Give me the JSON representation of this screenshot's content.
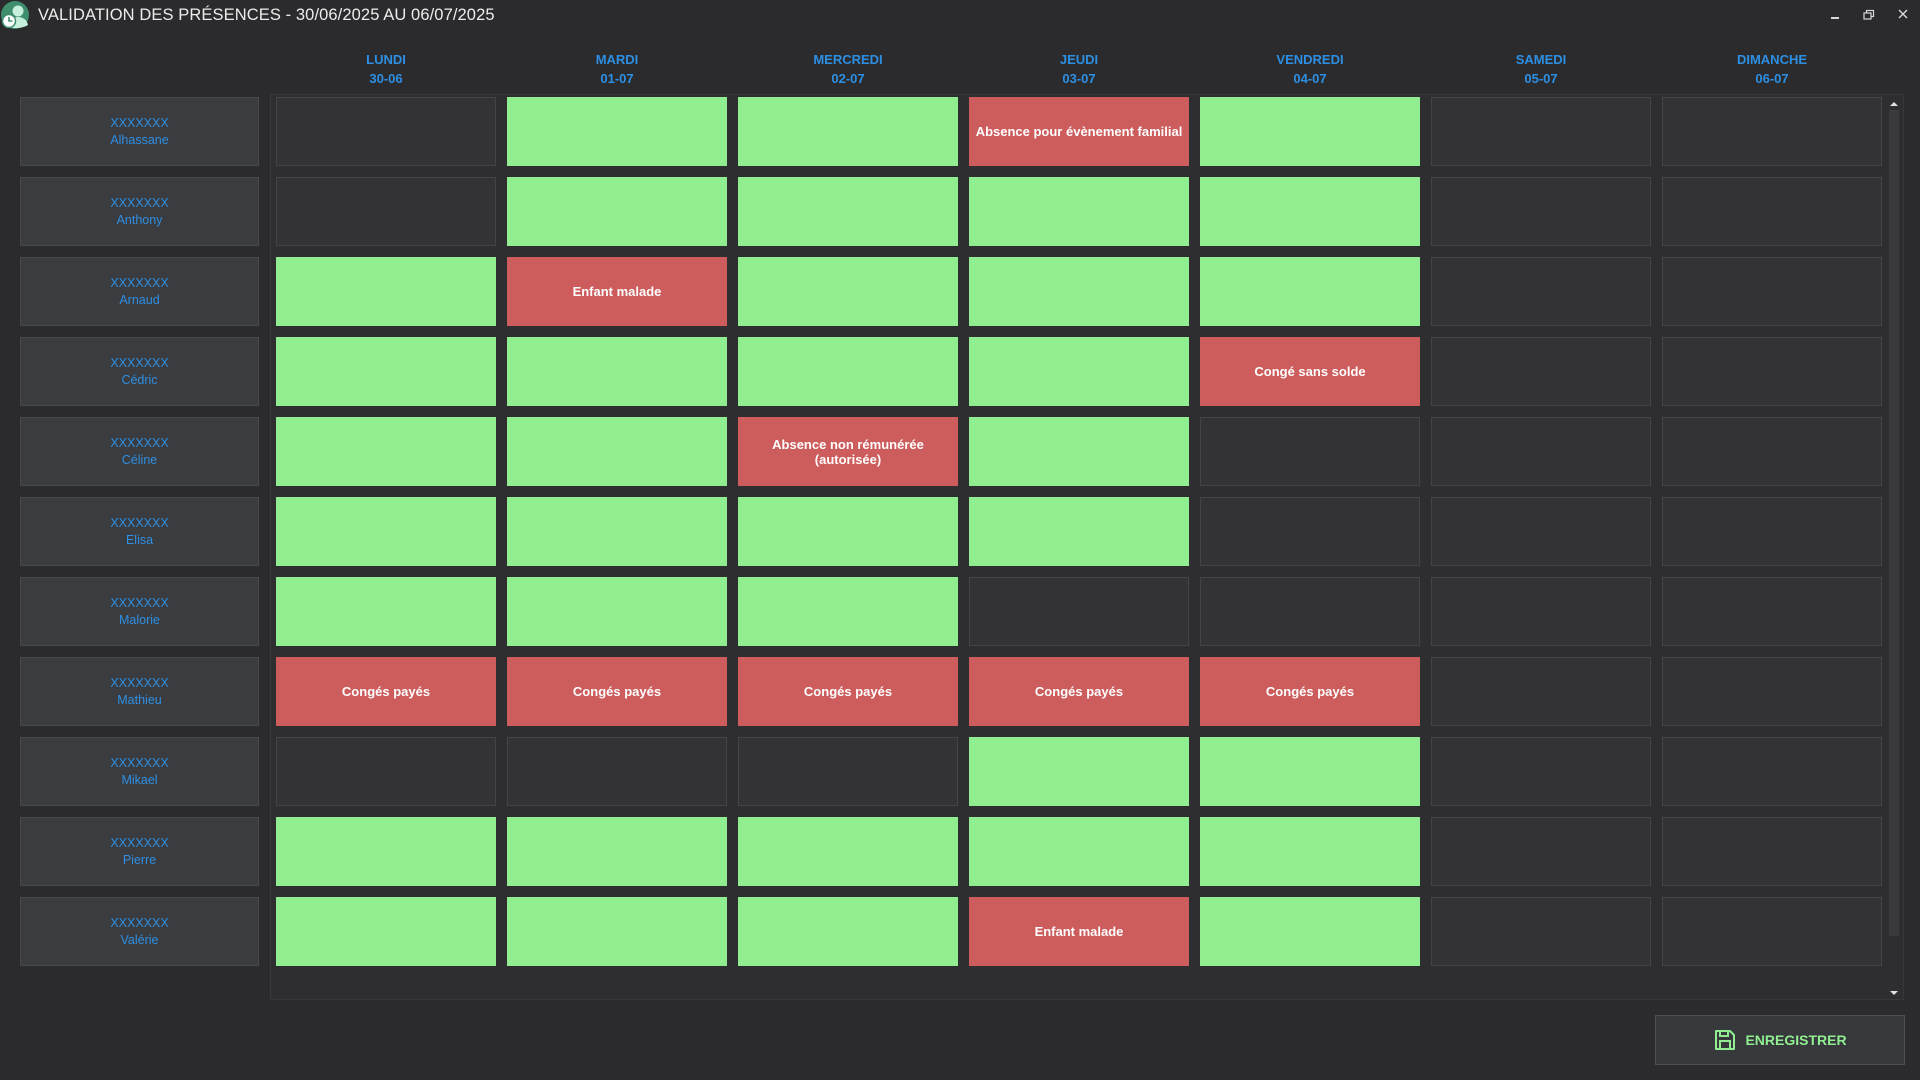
{
  "window": {
    "title": "VALIDATION DES PRÉSENCES - 30/06/2025 AU 06/07/2025"
  },
  "icons": {
    "app": "user-clock-icon",
    "minimize": "minimize-icon",
    "restore": "restore-icon",
    "close": "close-icon",
    "save": "floppy-disk-icon",
    "scroll_up": "scroll-up-arrow-icon",
    "scroll_down": "scroll-down-arrow-icon"
  },
  "colors": {
    "accent": "#2d8fe3",
    "present": "#90ee90",
    "absent": "#cd5c5c",
    "empty": "#333337",
    "background": "#2b2b2e"
  },
  "days": [
    {
      "name": "LUNDI",
      "date": "30-06"
    },
    {
      "name": "MARDI",
      "date": "01-07"
    },
    {
      "name": "MERCREDI",
      "date": "02-07"
    },
    {
      "name": "JEUDI",
      "date": "03-07"
    },
    {
      "name": "VENDREDI",
      "date": "04-07"
    },
    {
      "name": "SAMEDI",
      "date": "05-07"
    },
    {
      "name": "DIMANCHE",
      "date": "06-07"
    }
  ],
  "employees": [
    {
      "surname": "XXXXXXX",
      "firstname": "Alhassane",
      "cells": [
        {
          "status": "empty"
        },
        {
          "status": "present"
        },
        {
          "status": "present"
        },
        {
          "status": "absent",
          "label": "Absence pour évènement familial"
        },
        {
          "status": "present"
        },
        {
          "status": "empty"
        },
        {
          "status": "empty"
        }
      ]
    },
    {
      "surname": "XXXXXXX",
      "firstname": "Anthony",
      "cells": [
        {
          "status": "empty"
        },
        {
          "status": "present"
        },
        {
          "status": "present"
        },
        {
          "status": "present"
        },
        {
          "status": "present"
        },
        {
          "status": "empty"
        },
        {
          "status": "empty"
        }
      ]
    },
    {
      "surname": "XXXXXXX",
      "firstname": "Arnaud",
      "cells": [
        {
          "status": "present"
        },
        {
          "status": "absent",
          "label": "Enfant malade"
        },
        {
          "status": "present"
        },
        {
          "status": "present"
        },
        {
          "status": "present"
        },
        {
          "status": "empty"
        },
        {
          "status": "empty"
        }
      ]
    },
    {
      "surname": "XXXXXXX",
      "firstname": "Cédric",
      "cells": [
        {
          "status": "present"
        },
        {
          "status": "present"
        },
        {
          "status": "present"
        },
        {
          "status": "present"
        },
        {
          "status": "absent",
          "label": "Congé sans solde"
        },
        {
          "status": "empty"
        },
        {
          "status": "empty"
        }
      ]
    },
    {
      "surname": "XXXXXXX",
      "firstname": "Céline",
      "cells": [
        {
          "status": "present"
        },
        {
          "status": "present"
        },
        {
          "status": "absent",
          "label": "Absence non rémunérée (autorisée)"
        },
        {
          "status": "present"
        },
        {
          "status": "empty"
        },
        {
          "status": "empty"
        },
        {
          "status": "empty"
        }
      ]
    },
    {
      "surname": "XXXXXXX",
      "firstname": "Elisa",
      "cells": [
        {
          "status": "present"
        },
        {
          "status": "present"
        },
        {
          "status": "present"
        },
        {
          "status": "present"
        },
        {
          "status": "empty"
        },
        {
          "status": "empty"
        },
        {
          "status": "empty"
        }
      ]
    },
    {
      "surname": "XXXXXXX",
      "firstname": "Malorie",
      "cells": [
        {
          "status": "present"
        },
        {
          "status": "present"
        },
        {
          "status": "present"
        },
        {
          "status": "empty"
        },
        {
          "status": "empty"
        },
        {
          "status": "empty"
        },
        {
          "status": "empty"
        }
      ]
    },
    {
      "surname": "XXXXXXX",
      "firstname": "Mathieu",
      "cells": [
        {
          "status": "absent",
          "label": "Congés payés"
        },
        {
          "status": "absent",
          "label": "Congés payés"
        },
        {
          "status": "absent",
          "label": "Congés payés"
        },
        {
          "status": "absent",
          "label": "Congés payés"
        },
        {
          "status": "absent",
          "label": "Congés payés"
        },
        {
          "status": "empty"
        },
        {
          "status": "empty"
        }
      ]
    },
    {
      "surname": "XXXXXXX",
      "firstname": "Mikael",
      "cells": [
        {
          "status": "empty"
        },
        {
          "status": "empty"
        },
        {
          "status": "empty"
        },
        {
          "status": "present"
        },
        {
          "status": "present"
        },
        {
          "status": "empty"
        },
        {
          "status": "empty"
        }
      ]
    },
    {
      "surname": "XXXXXXX",
      "firstname": "Pierre",
      "cells": [
        {
          "status": "present"
        },
        {
          "status": "present"
        },
        {
          "status": "present"
        },
        {
          "status": "present"
        },
        {
          "status": "present"
        },
        {
          "status": "empty"
        },
        {
          "status": "empty"
        }
      ]
    },
    {
      "surname": "XXXXXXX",
      "firstname": "Valérie",
      "cells": [
        {
          "status": "present"
        },
        {
          "status": "present"
        },
        {
          "status": "present"
        },
        {
          "status": "absent",
          "label": "Enfant malade"
        },
        {
          "status": "present"
        },
        {
          "status": "empty"
        },
        {
          "status": "empty"
        }
      ]
    }
  ],
  "footer": {
    "save_label": "ENREGISTRER"
  }
}
